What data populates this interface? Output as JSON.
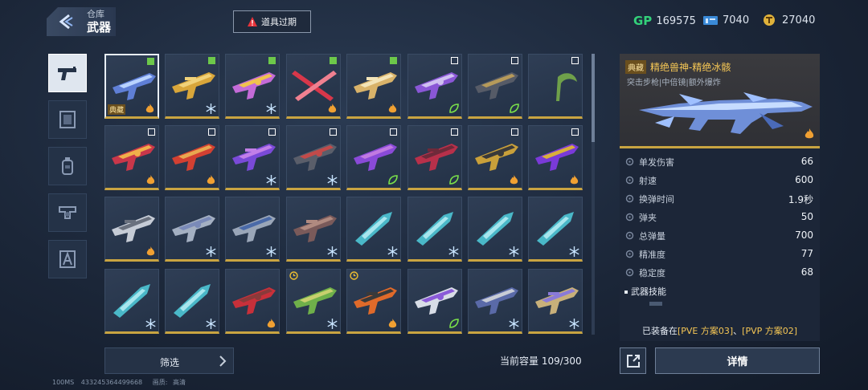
{
  "header": {
    "breadcrumb_parent": "仓库",
    "breadcrumb_current": "武器",
    "expired_button": "道具过期"
  },
  "currencies": [
    {
      "name": "gp",
      "mark": "GP",
      "value": "169575"
    },
    {
      "name": "tickets",
      "value": "7040"
    },
    {
      "name": "coins",
      "value": "27040"
    }
  ],
  "sidebar": {
    "tabs": [
      {
        "icon": "pistol-icon",
        "active": true
      },
      {
        "icon": "frame-icon",
        "active": false
      },
      {
        "icon": "grenade-icon",
        "active": false
      },
      {
        "icon": "badge-icon",
        "active": false
      },
      {
        "icon": "character-icon",
        "active": false
      }
    ]
  },
  "grid": {
    "items": [
      {
        "tag": "典藏",
        "check": "on",
        "corner": "fire",
        "palette": [
          "#5f7fd6",
          "#b9d3ff"
        ]
      },
      {
        "check": "on",
        "corner": "snow",
        "palette": [
          "#d9a63a",
          "#f1d27a"
        ]
      },
      {
        "check": "on",
        "corner": "snow",
        "palette": [
          "#c46bd8",
          "#f0c34e"
        ]
      },
      {
        "check": "on",
        "corner": "fire",
        "palette": [
          "#d8374a",
          "#f08090"
        ]
      },
      {
        "check": "on",
        "corner": "fire",
        "palette": [
          "#d9b36a",
          "#f3e4b8"
        ]
      },
      {
        "check": "off",
        "corner": "leaf",
        "palette": [
          "#8a57d6",
          "#cfc0f0"
        ]
      },
      {
        "check": "off",
        "corner": "leaf",
        "palette": [
          "#565b67",
          "#b69a5a"
        ]
      },
      {
        "check": "off",
        "corner": "none",
        "palette": [
          "#6fa04a",
          "#a3d06e"
        ]
      },
      {
        "check": "off",
        "corner": "fire",
        "palette": [
          "#c9374a",
          "#f0b04a"
        ]
      },
      {
        "check": "off",
        "corner": "fire",
        "palette": [
          "#d24032",
          "#e8a850"
        ]
      },
      {
        "check": "off",
        "corner": "snow",
        "palette": [
          "#7a4ad8",
          "#c27fe8"
        ]
      },
      {
        "check": "off",
        "corner": "snow",
        "palette": [
          "#5a5e6a",
          "#c24a4a"
        ]
      },
      {
        "check": "off",
        "corner": "leaf",
        "palette": [
          "#8a4ad8",
          "#c07ae0"
        ]
      },
      {
        "check": "off",
        "corner": "leaf",
        "palette": [
          "#b8304a",
          "#6e2a3a"
        ]
      },
      {
        "check": "off",
        "corner": "fire",
        "palette": [
          "#c9a03a",
          "#3a3a3a"
        ]
      },
      {
        "check": "off",
        "corner": "fire",
        "palette": [
          "#7a3ad8",
          "#d9b03a"
        ]
      },
      {
        "check": "none",
        "corner": "fire",
        "palette": [
          "#c6ccd6",
          "#6a717e"
        ]
      },
      {
        "check": "none",
        "corner": "snow",
        "palette": [
          "#a4b0c2",
          "#7a8ab8"
        ]
      },
      {
        "check": "none",
        "corner": "snow",
        "palette": [
          "#9aa6b8",
          "#4a6aa8"
        ]
      },
      {
        "check": "none",
        "corner": "snow",
        "palette": [
          "#7a5a5a",
          "#b08a80"
        ]
      },
      {
        "check": "none",
        "corner": "snow",
        "palette": [
          "#4ab8c8",
          "#a8e6ee"
        ]
      },
      {
        "check": "none",
        "corner": "snow",
        "palette": [
          "#4ab8c8",
          "#a8e6ee"
        ]
      },
      {
        "check": "none",
        "corner": "snow",
        "palette": [
          "#4ab8c8",
          "#a8e6ee"
        ]
      },
      {
        "check": "none",
        "corner": "snow",
        "palette": [
          "#4ab8c8",
          "#a8e6ee"
        ]
      },
      {
        "check": "none",
        "corner": "snow",
        "palette": [
          "#4ab8c8",
          "#a8e6ee"
        ]
      },
      {
        "check": "none",
        "corner": "snow",
        "palette": [
          "#4ab8c8",
          "#a8e6ee"
        ]
      },
      {
        "check": "none",
        "corner": "fire",
        "palette": [
          "#c8303a",
          "#8a3a3a"
        ]
      },
      {
        "check": "none",
        "corner": "snow",
        "clock": true,
        "palette": [
          "#6fb04a",
          "#c8d06e"
        ]
      },
      {
        "check": "none",
        "corner": "fire",
        "clock": true,
        "palette": [
          "#e06a2a",
          "#3a3a3a"
        ]
      },
      {
        "check": "none",
        "corner": "leaf",
        "palette": [
          "#d8dde6",
          "#8a5ad8"
        ]
      },
      {
        "check": "none",
        "corner": "snow",
        "palette": [
          "#5a6aa8",
          "#c8ccd6"
        ]
      },
      {
        "check": "none",
        "corner": "snow",
        "palette": [
          "#c8b07a",
          "#8a7ad8"
        ]
      }
    ]
  },
  "filter": {
    "label": "筛选"
  },
  "capacity": "当前容量 109/300",
  "detail": {
    "tag": "典藏",
    "name": "精绝兽神-精绝冰骸",
    "subtitle": "突击步枪|中倍镜|额外爆炸",
    "stats": [
      {
        "label": "单发伤害",
        "value": "66",
        "icon": "damage-icon"
      },
      {
        "label": "射速",
        "value": "600",
        "icon": "fire-rate-icon"
      },
      {
        "label": "换弹时间",
        "value": "1.9秒",
        "icon": "reload-icon"
      },
      {
        "label": "弹夹",
        "value": "50",
        "icon": "magazine-icon"
      },
      {
        "label": "总弹量",
        "value": "700",
        "icon": "ammo-icon"
      },
      {
        "label": "精准度",
        "value": "77",
        "icon": "accuracy-icon"
      },
      {
        "label": "稳定度",
        "value": "68",
        "icon": "stability-icon"
      }
    ],
    "skill_title": "武器技能",
    "equipped_prefix": "已装备在",
    "equipped_pve": "[PVE 方案03]",
    "equipped_sep": "、",
    "equipped_pvp": "[PVP 方案02]"
  },
  "actions": {
    "details_label": "详情"
  },
  "footer": {
    "ping": "100MS",
    "id": "433245364499668",
    "quality_label": "画质:",
    "quality_value": "高清"
  },
  "colors": {
    "accent_gold": "#f6c755",
    "check_green": "#6dc84a",
    "gp_green": "#33d17a"
  }
}
